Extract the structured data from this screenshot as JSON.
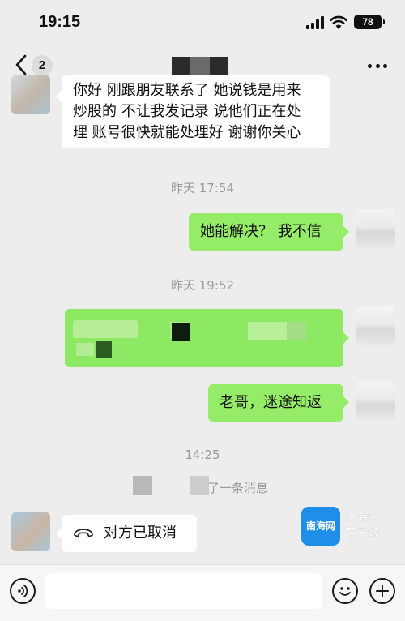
{
  "status_bar": {
    "time": "19:15",
    "battery": "78"
  },
  "nav": {
    "unread_count": "2"
  },
  "messages": {
    "m1": {
      "lines": [
        "你好 刚跟朋友联系了 她说钱是用来",
        "炒股的 不让我发记录 说他们正在处",
        "理 账号很快就能处理好 谢谢你关心"
      ]
    },
    "ts1": "昨天 17:54",
    "m2": {
      "text": "她能解决？ 我不信"
    },
    "ts2": "昨天 19:52",
    "m4": {
      "text": "老哥，迷途知返"
    },
    "ts3": "14:25",
    "recall_notice": "了一条消息",
    "m5": {
      "text": "对方已取消"
    }
  },
  "watermark": {
    "logo": "南海网",
    "line1": "南海网",
    "line2": "客户端"
  },
  "colors": {
    "bubble_green": "#95ec69",
    "background": "#ededed",
    "logo_blue": "#1e8ee8"
  }
}
